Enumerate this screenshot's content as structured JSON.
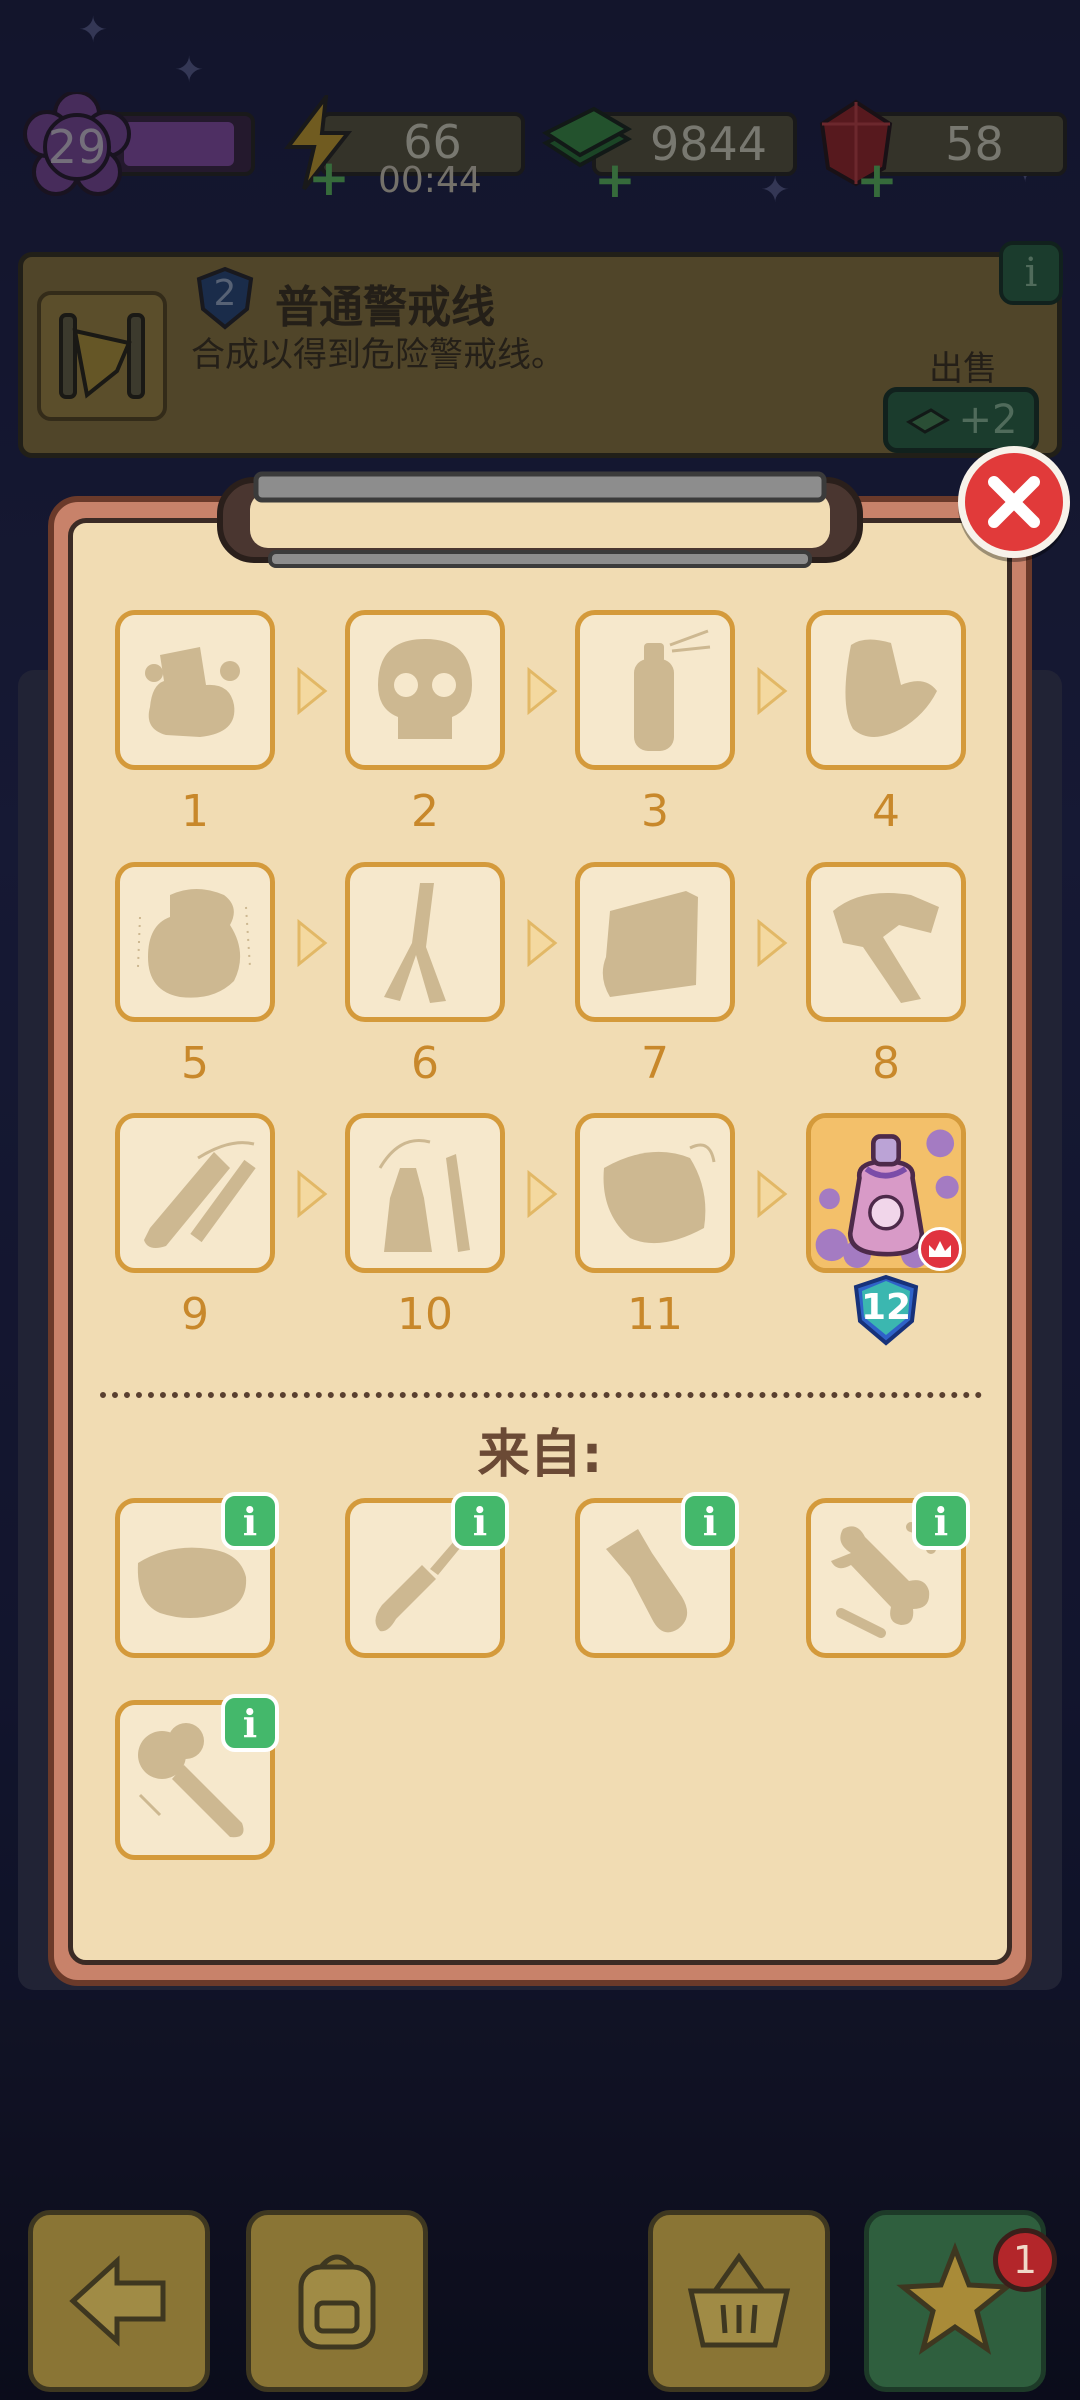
{
  "top_bar": {
    "level": "29",
    "energy": "66",
    "energy_timer": "00:44",
    "cash": "9844",
    "gems": "58"
  },
  "banner": {
    "item_level": "2",
    "item_name": "普通警戒线",
    "description": "合成以得到危险警戒线。",
    "sell_label": "出售",
    "sell_price": "+2"
  },
  "chain": {
    "items": [
      {
        "label": "1",
        "icon": "dirt-pile-icon",
        "unlocked": false
      },
      {
        "label": "2",
        "icon": "skull-icon",
        "unlocked": false
      },
      {
        "label": "3",
        "icon": "spray-can-icon",
        "unlocked": false
      },
      {
        "label": "4",
        "icon": "glove-icon",
        "unlocked": false
      },
      {
        "label": "5",
        "icon": "sack-icon",
        "unlocked": false
      },
      {
        "label": "6",
        "icon": "pliers-icon",
        "unlocked": false
      },
      {
        "label": "7",
        "icon": "box-icon",
        "unlocked": false
      },
      {
        "label": "8",
        "icon": "hammer-icon",
        "unlocked": false
      },
      {
        "label": "9",
        "icon": "brush-icon",
        "unlocked": false
      },
      {
        "label": "10",
        "icon": "bottle-knife-icon",
        "unlocked": false
      },
      {
        "label": "11",
        "icon": "pillow-icon",
        "unlocked": false
      },
      {
        "label": "12",
        "icon": "perfume-bottle-icon",
        "unlocked": true
      }
    ]
  },
  "from_section": {
    "title": "来自:",
    "sources": [
      {
        "icon": "rock-pile-icon"
      },
      {
        "icon": "screwdriver-icon"
      },
      {
        "icon": "flashlight-icon"
      },
      {
        "icon": "bone-icon"
      },
      {
        "icon": "mallet-icon"
      }
    ]
  },
  "bottom_nav": {
    "notification_count": "1"
  },
  "colors": {
    "paper": "#f1dcb3",
    "cell_border": "#d49a3b",
    "silhouette": "#cdb891",
    "info_green": "#44b86b",
    "close_red": "#e13a3a"
  }
}
